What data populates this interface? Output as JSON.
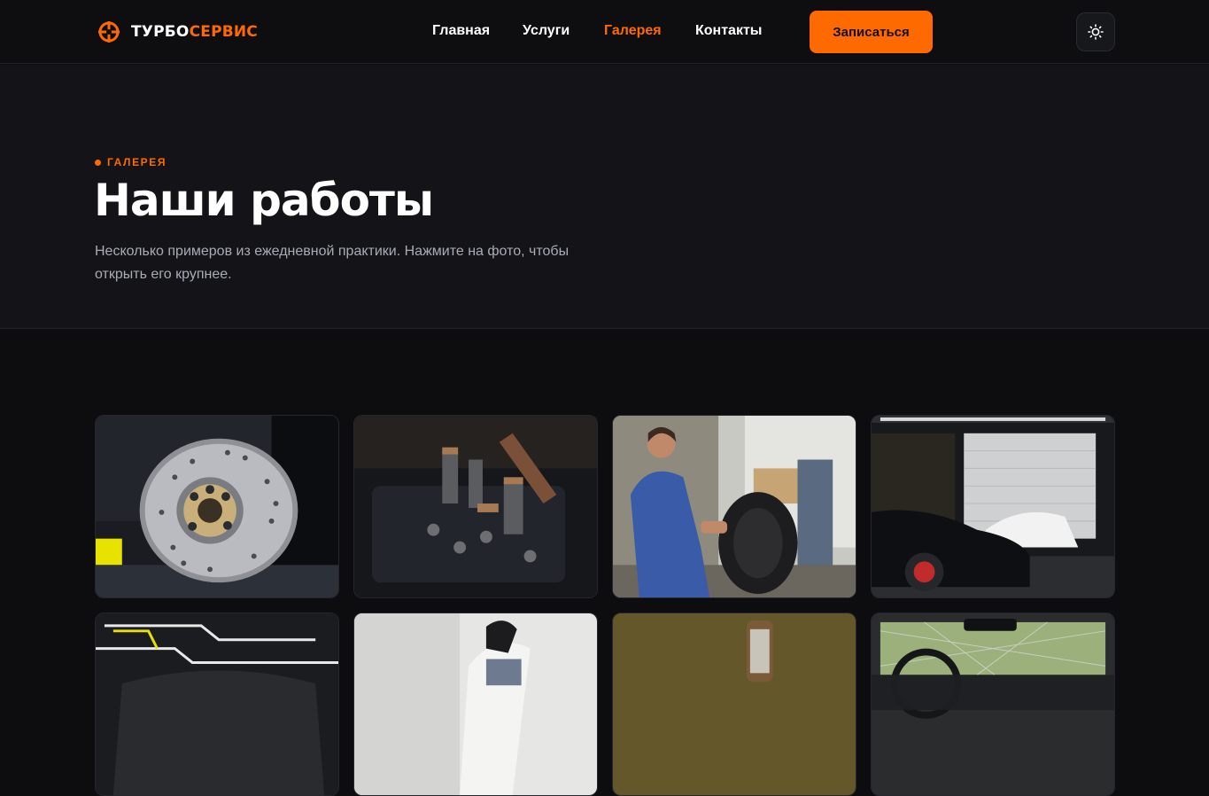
{
  "brand": {
    "name_part1": "ТУРБО",
    "name_part2": "СЕРВИС",
    "accent_color": "#ff6a00"
  },
  "nav": {
    "items": [
      {
        "label": "Главная",
        "active": false
      },
      {
        "label": "Услуги",
        "active": false
      },
      {
        "label": "Галерея",
        "active": true
      },
      {
        "label": "Контакты",
        "active": false
      }
    ]
  },
  "header": {
    "cta_label": "Записаться",
    "theme_toggle_icon": "sun-icon"
  },
  "hero": {
    "eyebrow": "ГАЛЕРЕЯ",
    "title": "Наши работы",
    "subtitle": "Несколько примеров из ежедневной практики. Нажмите на фото, чтобы открыть его крупнее."
  },
  "gallery": {
    "photos": [
      {
        "subject": "brake-disc-photo"
      },
      {
        "subject": "engine-bay-photo"
      },
      {
        "subject": "mechanic-with-tire-photo"
      },
      {
        "subject": "garage-sports-cars-photo"
      },
      {
        "subject": "detailing-studio-car-photo"
      },
      {
        "subject": "mechanic-gloves-photo"
      },
      {
        "subject": "blurred-workshop-photo"
      },
      {
        "subject": "car-interior-dashboard-photo"
      }
    ]
  }
}
